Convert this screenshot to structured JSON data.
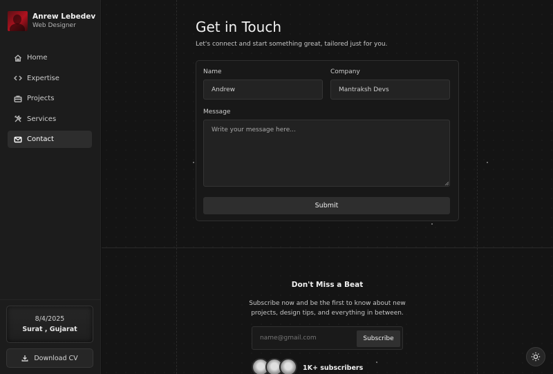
{
  "profile": {
    "name": "Anrew Lebedev",
    "role": "Web Designer"
  },
  "nav": {
    "items": [
      {
        "label": "Home",
        "icon": "home-icon"
      },
      {
        "label": "Expertise",
        "icon": "code-icon"
      },
      {
        "label": "Projects",
        "icon": "briefcase-icon"
      },
      {
        "label": "Services",
        "icon": "tools-icon"
      },
      {
        "label": "Contact",
        "icon": "mail-icon",
        "active": true
      }
    ]
  },
  "sidebar_footer": {
    "date": "8/4/2025",
    "location": "Surat , Gujarat",
    "download_label": "Download CV"
  },
  "contact": {
    "title": "Get in Touch",
    "subtitle": "Let's connect and start something great, tailored just for you.",
    "name_label": "Name",
    "name_value": "Andrew",
    "company_label": "Company",
    "company_value": "Mantraksh Devs",
    "message_label": "Message",
    "message_placeholder": "Write your message here...",
    "submit_label": "Submit"
  },
  "newsletter": {
    "title": "Don't Miss a Beat",
    "description": "Subscribe now and be the first to know about new projects, design tips, and everything in between.",
    "email_placeholder": "name@gmail.com",
    "button_label": "Subscribe",
    "subscriber_count": "1K+ subscribers"
  },
  "colors": {
    "background": "#151515",
    "sidebar": "#1c1c1c",
    "active_nav": "#2d2d2d",
    "accent_avatar": "#b0121f"
  }
}
